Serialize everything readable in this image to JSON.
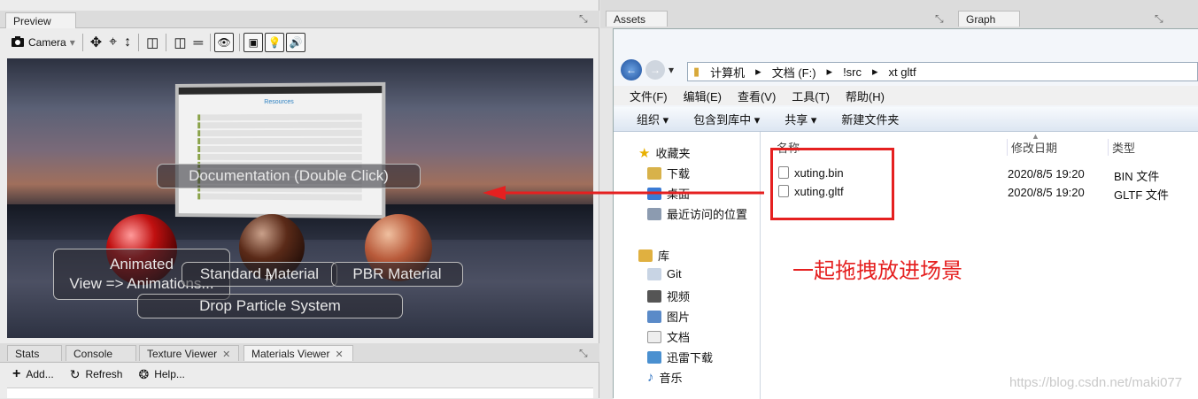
{
  "preview": {
    "tab": "Preview",
    "camera_label": "Camera"
  },
  "viewport": {
    "doc_panel_title": "Resources",
    "labels": {
      "documentation": "Documentation (Double Click)",
      "animated_line1": "Animated",
      "animated_line2": "View => Animations...",
      "standard": "Standard Material",
      "pbr": "PBR Material",
      "particle": "Drop Particle System"
    }
  },
  "bottom_tabs": [
    "Stats",
    "Console",
    "Texture Viewer",
    "Materials Viewer"
  ],
  "bottom_toolbar": {
    "add": "Add...",
    "refresh": "Refresh",
    "help": "Help..."
  },
  "right_tabs": {
    "assets": "Assets",
    "graph": "Graph"
  },
  "explorer": {
    "breadcrumbs": [
      "计算机",
      "文档 (F:)",
      "!src",
      "xt gltf"
    ],
    "menu": [
      "文件(F)",
      "编辑(E)",
      "查看(V)",
      "工具(T)",
      "帮助(H)"
    ],
    "commands": [
      "组织 ▾",
      "包含到库中 ▾",
      "共享 ▾",
      "新建文件夹"
    ],
    "favorites_title": "收藏夹",
    "favorites": [
      "下载",
      "桌面",
      "最近访问的位置"
    ],
    "libraries_title": "库",
    "libraries": [
      "Git",
      "视频",
      "图片",
      "文档",
      "迅雷下载",
      "音乐"
    ],
    "columns": {
      "name": "名称",
      "date": "修改日期",
      "type": "类型"
    },
    "files": [
      {
        "name": "xuting.bin",
        "date": "2020/8/5 19:20",
        "type": "BIN 文件"
      },
      {
        "name": "xuting.gltf",
        "date": "2020/8/5 19:20",
        "type": "GLTF 文件"
      }
    ]
  },
  "annotation": "一起拖拽放进场景",
  "watermark": "https://blog.csdn.net/maki077",
  "colors": {
    "annotation_red": "#e52020"
  }
}
